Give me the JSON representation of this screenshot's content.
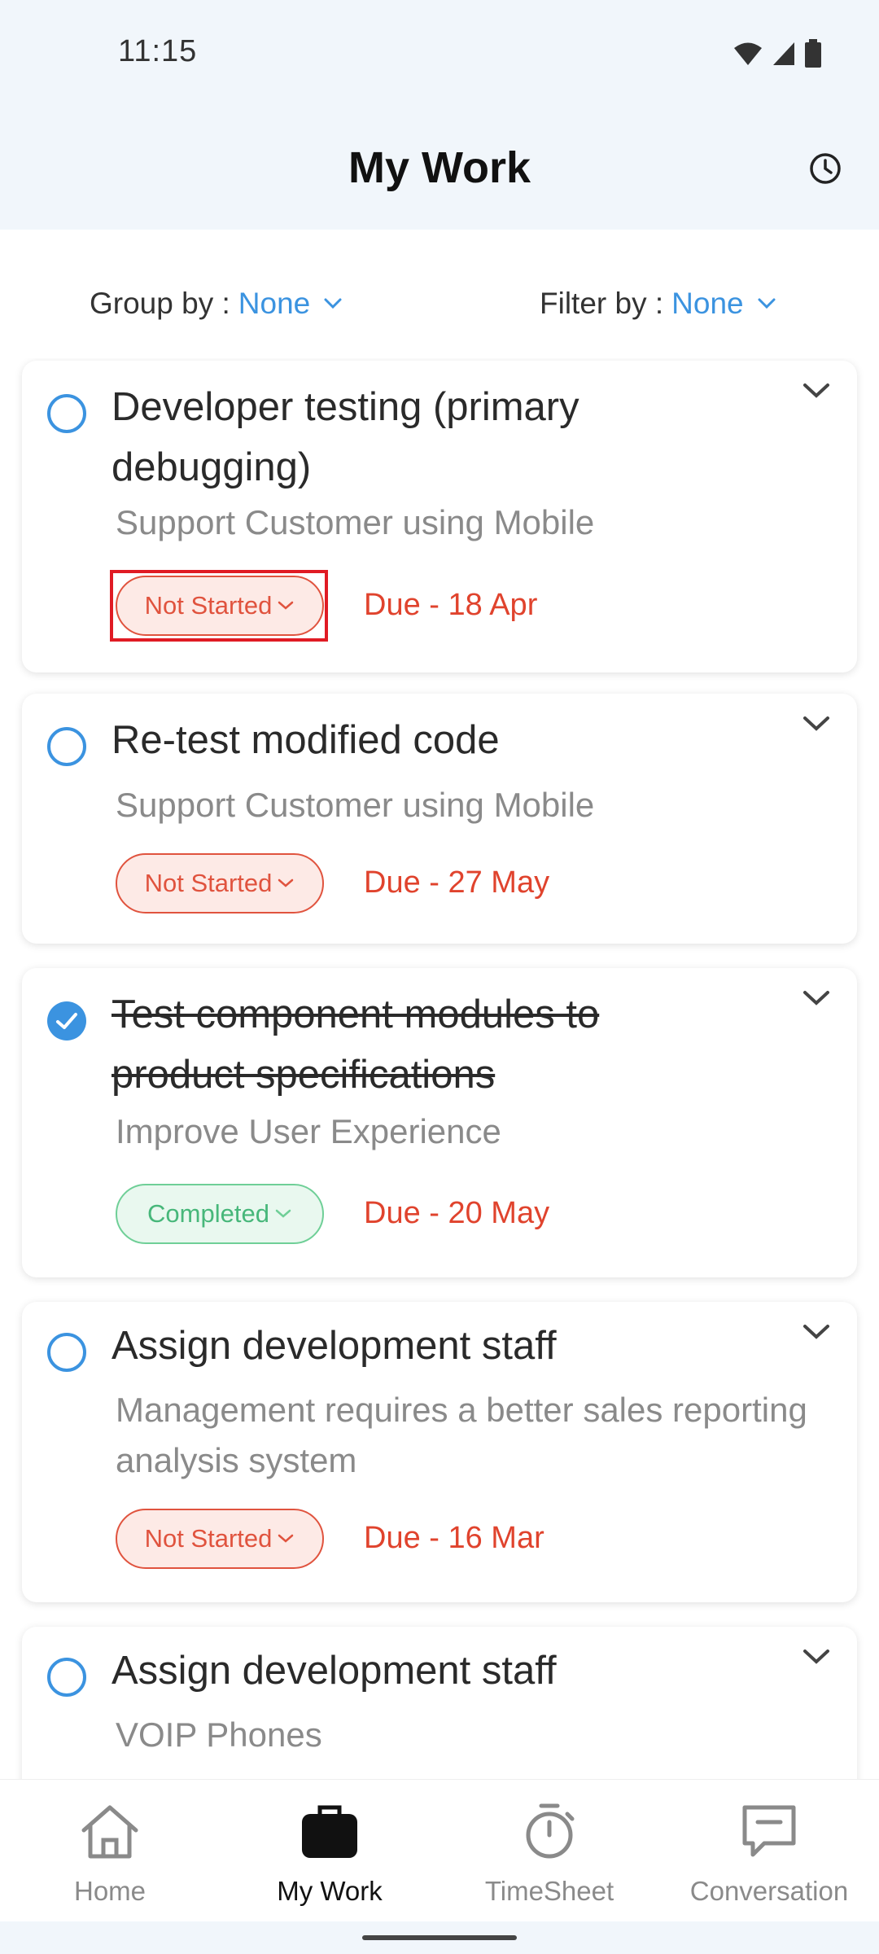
{
  "status_bar": {
    "time": "11:15",
    "icons": [
      "wifi-icon",
      "signal-icon",
      "battery-icon"
    ]
  },
  "header": {
    "title": "My Work",
    "action_icon": "history-clock-icon"
  },
  "filters": {
    "group_by": {
      "label": "Group by :",
      "value": "None"
    },
    "filter_by": {
      "label": "Filter by :",
      "value": "None"
    }
  },
  "tasks": [
    {
      "title": "Developer testing (primary debugging)",
      "project": "Support Customer using Mobile",
      "status": "Not Started",
      "due": "Due - 18 Apr",
      "completed": false
    },
    {
      "title": "Re-test modified code",
      "project": "Support Customer using Mobile",
      "status": "Not Started",
      "due": "Due - 27 May",
      "completed": false
    },
    {
      "title": "Test component modules to product specifications",
      "project": "Improve User Experience",
      "status": "Completed",
      "due": "Due - 20 May",
      "completed": true
    },
    {
      "title": "Assign development staff",
      "project": "Management requires a better sales reporting analysis system",
      "status": "Not Started",
      "due": "Due - 16 Mar",
      "completed": false
    },
    {
      "title": "Assign development staff",
      "project": "VOIP Phones",
      "completed": false
    }
  ],
  "bottom_nav": [
    {
      "label": "Home",
      "icon": "home-icon",
      "active": false
    },
    {
      "label": "My Work",
      "icon": "briefcase-icon",
      "active": true
    },
    {
      "label": "TimeSheet",
      "icon": "stopwatch-icon",
      "active": false
    },
    {
      "label": "Conversation",
      "icon": "chat-icon",
      "active": false
    }
  ],
  "colors": {
    "accent": "#3b93e0",
    "danger": "#e0432d",
    "success": "#47b77a",
    "header_bg": "#f1f6fb"
  }
}
